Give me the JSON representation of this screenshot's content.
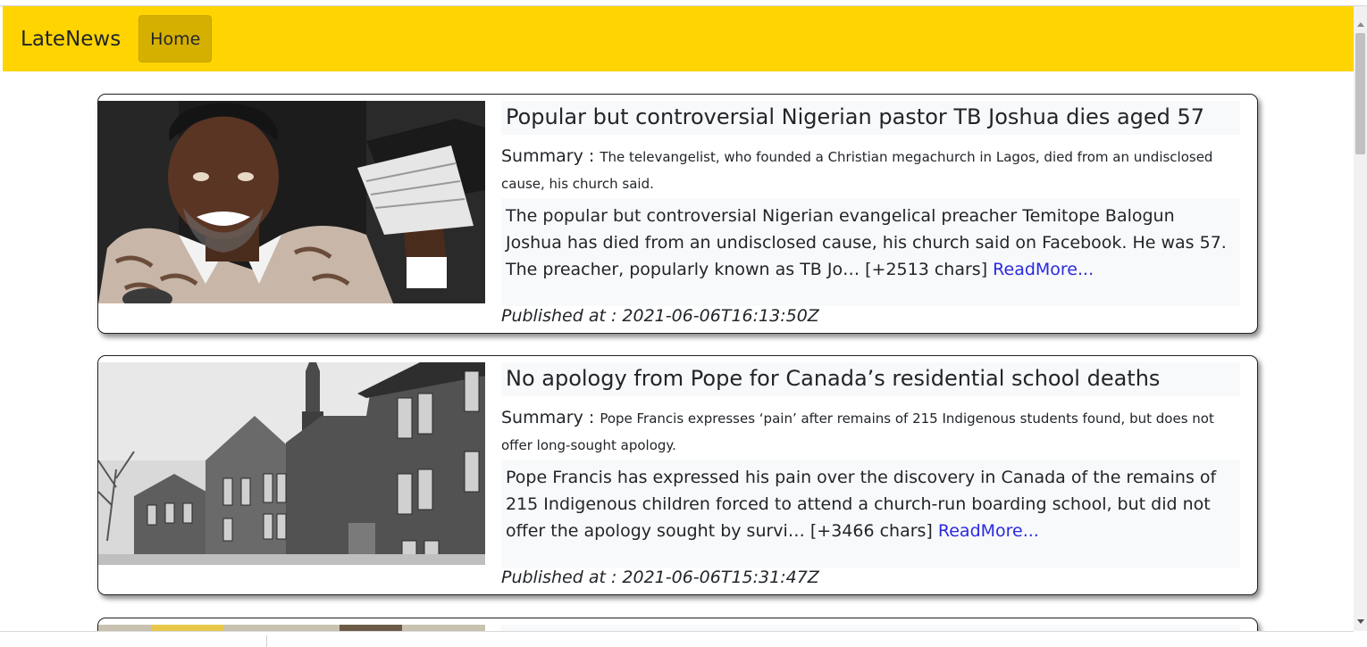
{
  "navbar": {
    "brand": "LateNews",
    "home_label": "Home",
    "background_color": "#ffd400"
  },
  "articles": [
    {
      "title": "Popular but controversial Nigerian pastor TB Joshua dies aged 57",
      "summary_label": "Summary : ",
      "summary": "The televangelist, who founded a Christian megachurch in Lagos, died from an undisclosed cause, his church said.",
      "content": "The popular but controversial Nigerian evangelical preacher Temitope Balogun Joshua has died from an undisclosed cause, his church said on Facebook. He was 57. The preacher, popularly known as TB Jo… [+2513 chars] ",
      "readmore": "ReadMore...",
      "published_at": "Published at : 2021-06-06T16:13:50Z",
      "image_icon": "portrait-photo"
    },
    {
      "title": "No apology from Pope for Canada’s residential school deaths",
      "summary_label": "Summary : ",
      "summary": "Pope Francis expresses ‘pain’ after remains of 215 Indigenous students found, but does not offer long-sought apology.",
      "content": "Pope Francis has expressed his pain over the discovery in Canada of the remains of 215 Indigenous children forced to attend a church-run boarding school, but did not offer the apology sought by survi… [+3466 chars] ",
      "readmore": "ReadMore...",
      "published_at": "Published at : 2021-06-06T15:31:47Z",
      "image_icon": "school-building-photo"
    }
  ],
  "colors": {
    "link": "#2a2ae0",
    "panel": "#f8f9fa"
  }
}
